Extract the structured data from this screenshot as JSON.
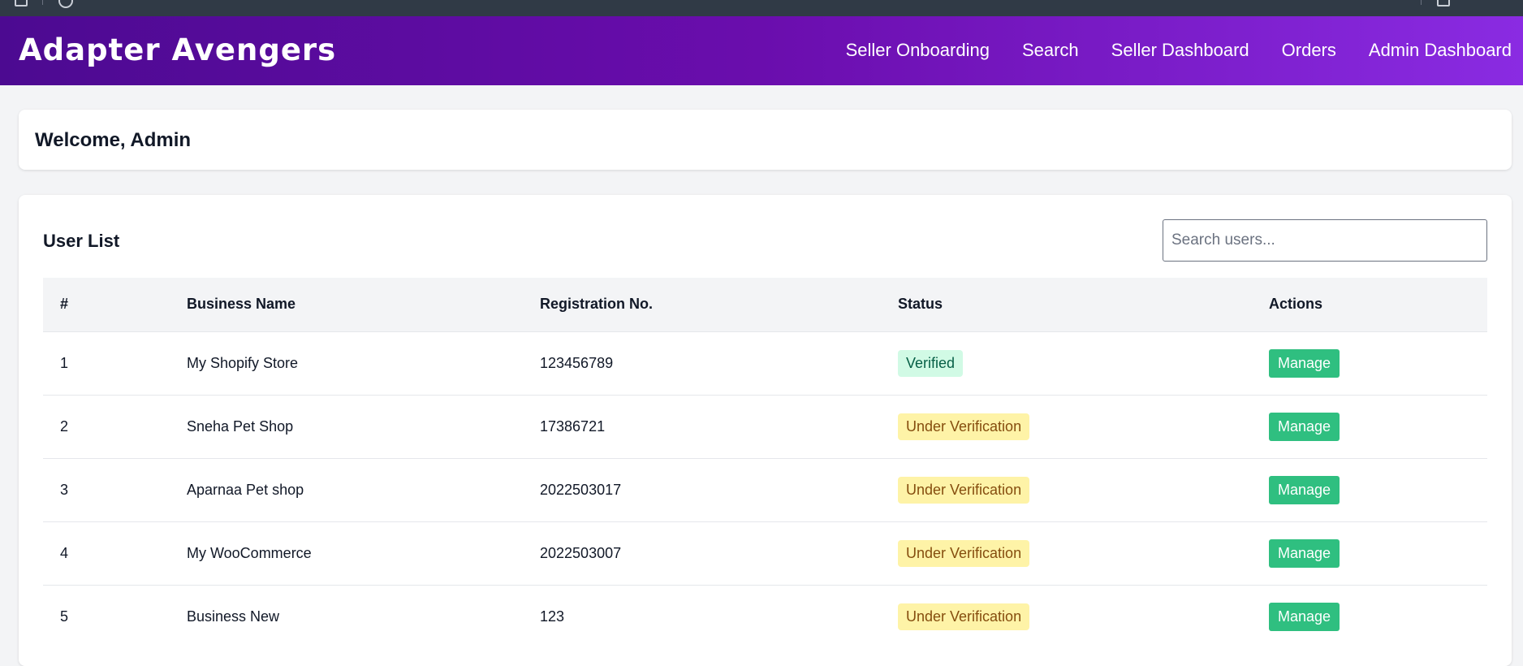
{
  "header": {
    "brand": "Adapter Avengers",
    "nav": [
      {
        "label": "Seller Onboarding"
      },
      {
        "label": "Search"
      },
      {
        "label": "Seller Dashboard"
      },
      {
        "label": "Orders"
      },
      {
        "label": "Admin Dashboard"
      }
    ]
  },
  "welcome": {
    "title": "Welcome, Admin"
  },
  "user_list": {
    "title": "User List",
    "search_placeholder": "Search users...",
    "columns": [
      "#",
      "Business Name",
      "Registration No.",
      "Status",
      "Actions"
    ],
    "rows": [
      {
        "num": "1",
        "business": "My Shopify Store",
        "reg": "123456789",
        "status": "Verified",
        "action": "Manage"
      },
      {
        "num": "2",
        "business": "Sneha Pet Shop",
        "reg": "17386721",
        "status": "Under Verification",
        "action": "Manage"
      },
      {
        "num": "3",
        "business": "Aparnaa Pet shop",
        "reg": "2022503017",
        "status": "Under Verification",
        "action": "Manage"
      },
      {
        "num": "4",
        "business": "My WooCommerce",
        "reg": "2022503007",
        "status": "Under Verification",
        "action": "Manage"
      },
      {
        "num": "5",
        "business": "Business New",
        "reg": "123",
        "status": "Under Verification",
        "action": "Manage"
      }
    ]
  },
  "colors": {
    "brand_gradient_start": "#4c0a91",
    "brand_gradient_end": "#8a2be2",
    "manage_button": "#2fbf80",
    "verified_badge_bg": "#d1fae5",
    "pending_badge_bg": "#fef3a7"
  }
}
